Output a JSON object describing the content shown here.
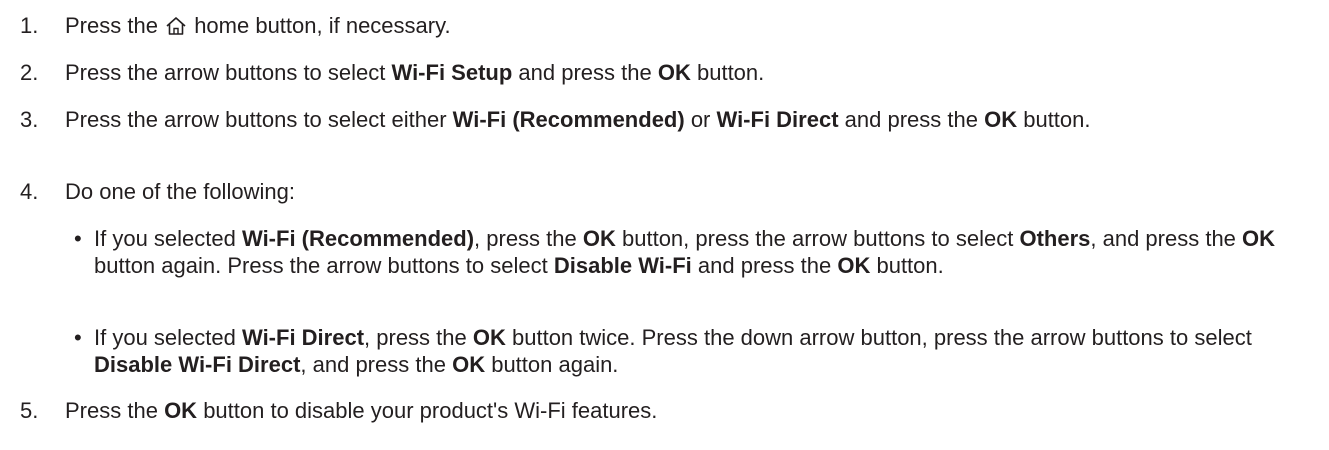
{
  "steps": [
    {
      "number": "1.",
      "pre": "Press the",
      "icon": "home-icon",
      "post": "home button, if necessary."
    },
    {
      "number": "2.",
      "t1": "Press the arrow buttons to select",
      "b1": "Wi-Fi Setup",
      "t2": "and press the",
      "b2": "OK",
      "t3": "button."
    },
    {
      "number": "3.",
      "t1": "Press the arrow buttons to select either",
      "b1": "Wi-Fi (Recommended)",
      "t2": "or",
      "b2": "Wi-Fi Direct",
      "t3": "and press the",
      "b3": "OK",
      "t4": "button."
    },
    {
      "number": "4.",
      "text": "Do one of the following:"
    },
    {
      "number": "5.",
      "t1": "Press the",
      "b1": "OK",
      "t2": "button to disable your product's Wi-Fi features."
    }
  ],
  "bullets": [
    {
      "symbol": "•",
      "t1": "If you selected",
      "b1": "Wi-Fi (Recommended)",
      "t2": ", press the",
      "b2": "OK",
      "t3": "button, press the arrow buttons to select",
      "b3": "Others",
      "t4": ", and press the",
      "b4": "OK",
      "t5": "button again. Press the arrow buttons to select",
      "b5": "Disable Wi-Fi",
      "t6": "and press the",
      "b6": "OK",
      "t7": "button."
    },
    {
      "symbol": "•",
      "t1": "If you selected",
      "b1": "Wi-Fi Direct",
      "t2": ", press the",
      "b2": "OK",
      "t3": "button twice. Press the down arrow button, press the arrow buttons to select",
      "b3": "Disable Wi-Fi Direct",
      "t4": ", and press the",
      "b4": "OK",
      "t5": "button again."
    }
  ]
}
